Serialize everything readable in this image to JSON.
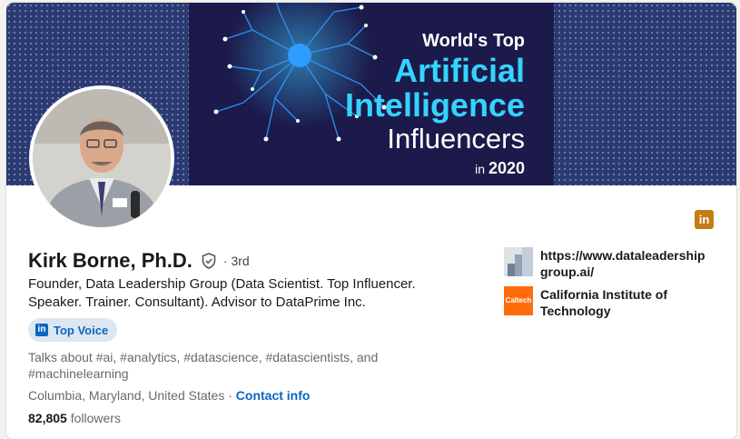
{
  "banner": {
    "line1": "World's Top",
    "line2": "Artificial",
    "line3": "Intelligence",
    "line4": "Influencers",
    "year_prefix": "in",
    "year": "2020"
  },
  "profile": {
    "name": "Kirk Borne, Ph.D.",
    "connection_degree": "· 3rd",
    "headline": "Founder, Data Leadership Group (Data Scientist. Top Influencer. Speaker. Trainer. Consultant). Advisor to DataPrime Inc.",
    "top_voice_label": "Top Voice",
    "talks_about": "Talks about #ai, #analytics, #datascience, #datascientists, and #machinelearning",
    "location": "Columbia, Maryland, United States",
    "separator": "·",
    "contact_info_label": "Contact info",
    "followers_count": "82,805",
    "followers_label": "followers"
  },
  "sidebar": {
    "website": "https://www.dataleadership group.ai/",
    "education": "California Institute of Technology",
    "education_logo_text": "Caltech"
  },
  "icons": {
    "linkedin_badge": "in",
    "top_voice_icon": "in"
  },
  "colors": {
    "accent_blue": "#0a66c2",
    "linkedin_gold": "#c37d16",
    "caltech_orange": "#ff6c0c"
  }
}
